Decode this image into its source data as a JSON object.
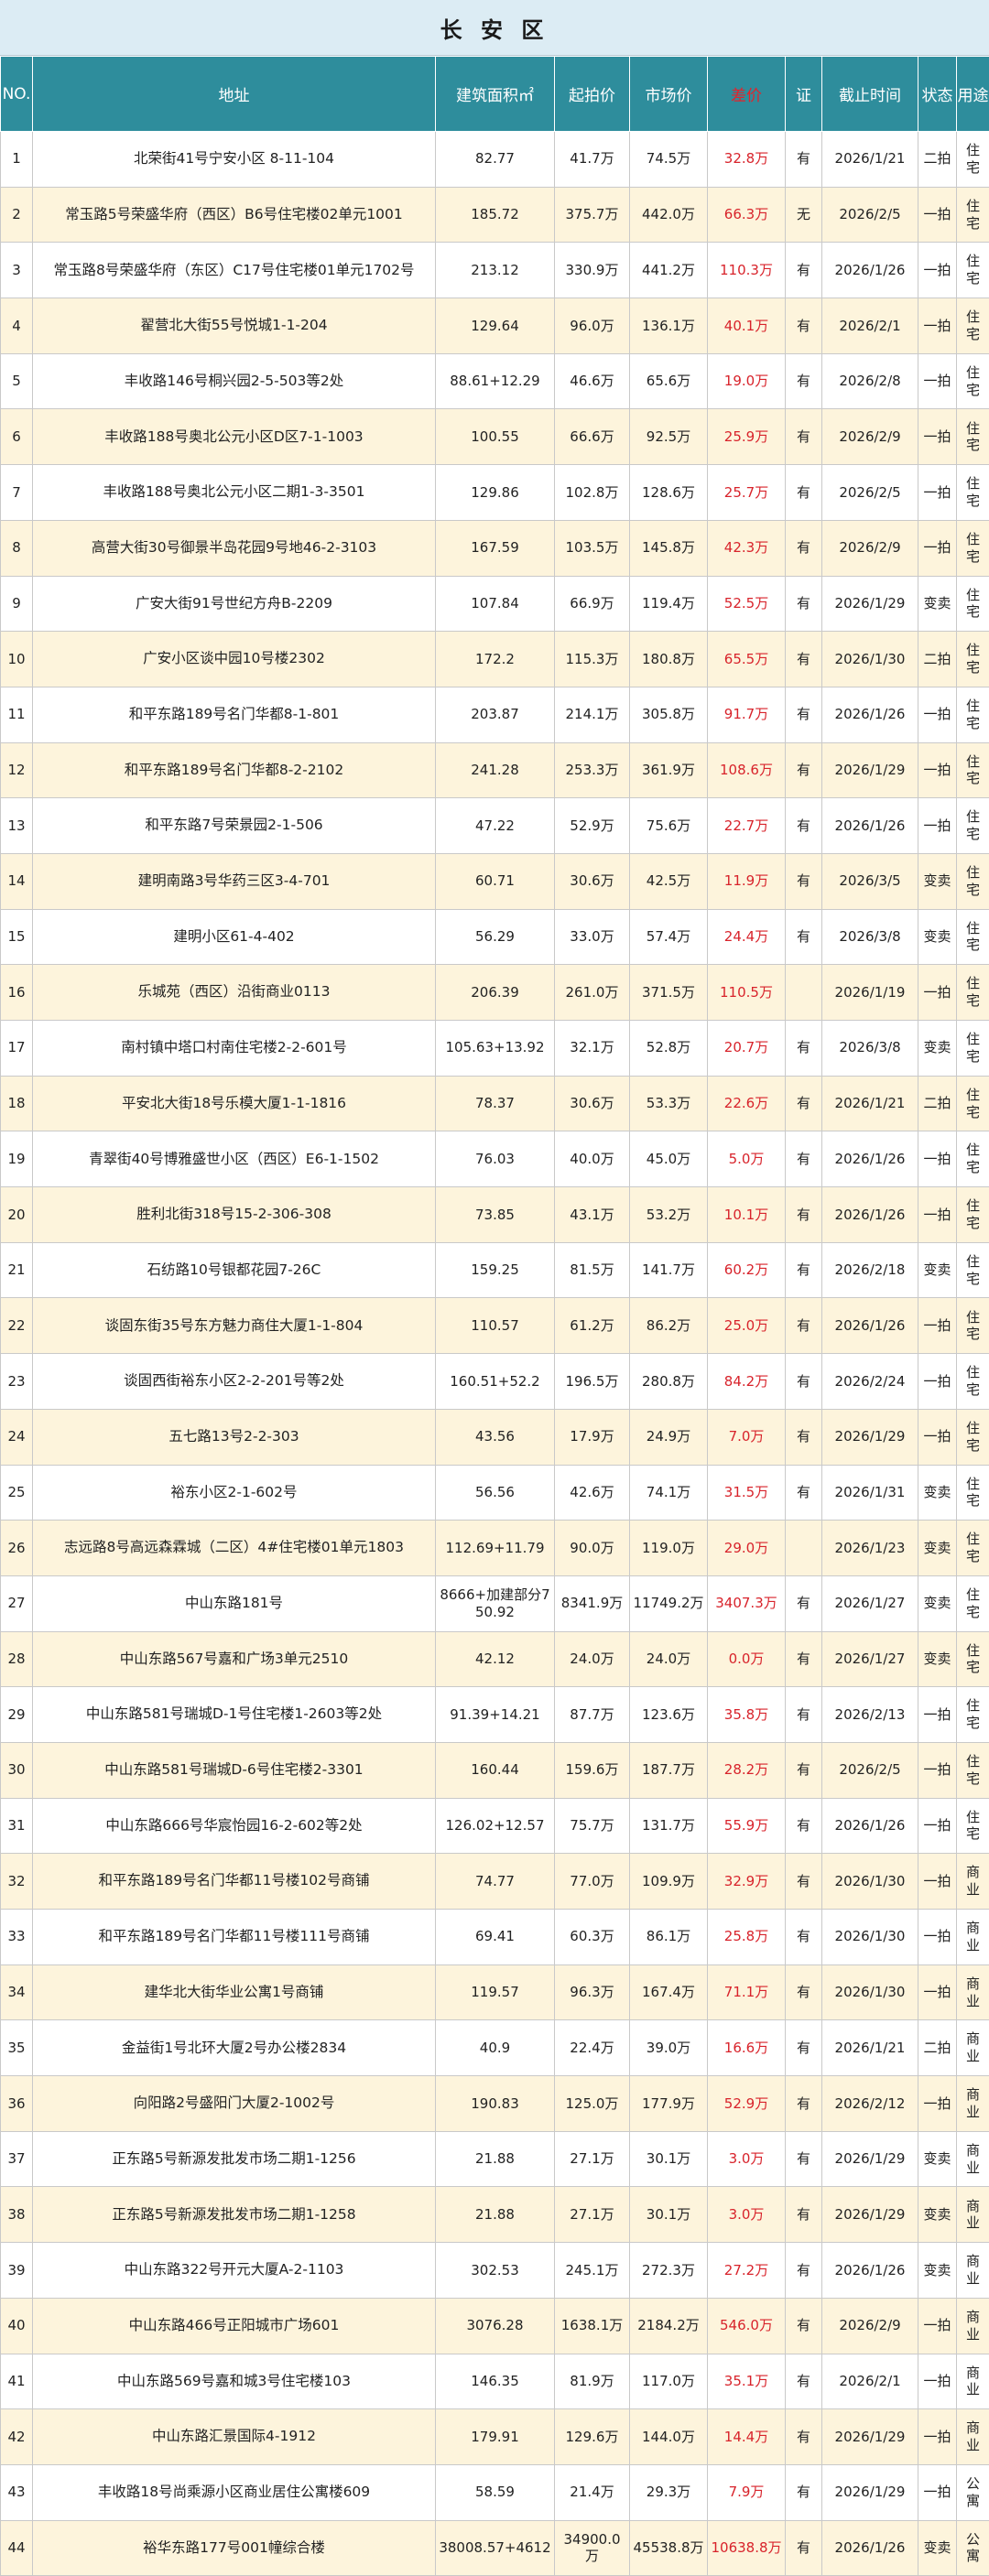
{
  "title": "长 安 区",
  "headers": {
    "no": "NO.",
    "address": "地址",
    "area": "建筑面积㎡",
    "start_price": "起拍价",
    "market_price": "市场价",
    "diff": "差价",
    "cert": "证",
    "deadline": "截止时间",
    "status": "状态",
    "usage": "用途"
  },
  "colors": {
    "header_bg": "#2e8d9c",
    "title_bg": "#dcecf4",
    "row_alt_bg": "#fdf4dc",
    "diff_color": "#d8232b"
  },
  "rows": [
    {
      "no": "1",
      "address": "北荣街41号宁安小区 8-11-104",
      "area": "82.77",
      "start": "41.7万",
      "market": "74.5万",
      "diff": "32.8万",
      "cert": "有",
      "deadline": "2026/1/21",
      "status": "二拍",
      "usage": "住宅"
    },
    {
      "no": "2",
      "address": "常玉路5号荣盛华府（西区）B6号住宅楼02单元1001",
      "area": "185.72",
      "start": "375.7万",
      "market": "442.0万",
      "diff": "66.3万",
      "cert": "无",
      "deadline": "2026/2/5",
      "status": "一拍",
      "usage": "住宅"
    },
    {
      "no": "3",
      "address": "常玉路8号荣盛华府（东区）C17号住宅楼01单元1702号",
      "area": "213.12",
      "start": "330.9万",
      "market": "441.2万",
      "diff": "110.3万",
      "cert": "有",
      "deadline": "2026/1/26",
      "status": "一拍",
      "usage": "住宅"
    },
    {
      "no": "4",
      "address": "翟营北大街55号悦城1-1-204",
      "area": "129.64",
      "start": "96.0万",
      "market": "136.1万",
      "diff": "40.1万",
      "cert": "有",
      "deadline": "2026/2/1",
      "status": "一拍",
      "usage": "住宅"
    },
    {
      "no": "5",
      "address": "丰收路146号桐兴园2-5-503等2处",
      "area": "88.61+12.29",
      "start": "46.6万",
      "market": "65.6万",
      "diff": "19.0万",
      "cert": "有",
      "deadline": "2026/2/8",
      "status": "一拍",
      "usage": "住宅"
    },
    {
      "no": "6",
      "address": "丰收路188号奥北公元小区D区7-1-1003",
      "area": "100.55",
      "start": "66.6万",
      "market": "92.5万",
      "diff": "25.9万",
      "cert": "有",
      "deadline": "2026/2/9",
      "status": "一拍",
      "usage": "住宅"
    },
    {
      "no": "7",
      "address": "丰收路188号奥北公元小区二期1-3-3501",
      "area": "129.86",
      "start": "102.8万",
      "market": "128.6万",
      "diff": "25.7万",
      "cert": "有",
      "deadline": "2026/2/5",
      "status": "一拍",
      "usage": "住宅"
    },
    {
      "no": "8",
      "address": "高营大街30号御景半岛花园9号地46-2-3103",
      "area": "167.59",
      "start": "103.5万",
      "market": "145.8万",
      "diff": "42.3万",
      "cert": "有",
      "deadline": "2026/2/9",
      "status": "一拍",
      "usage": "住宅"
    },
    {
      "no": "9",
      "address": "广安大街91号世纪方舟B-2209",
      "area": "107.84",
      "start": "66.9万",
      "market": "119.4万",
      "diff": "52.5万",
      "cert": "有",
      "deadline": "2026/1/29",
      "status": "变卖",
      "usage": "住宅"
    },
    {
      "no": "10",
      "address": "广安小区谈中园10号楼2302",
      "area": "172.2",
      "start": "115.3万",
      "market": "180.8万",
      "diff": "65.5万",
      "cert": "有",
      "deadline": "2026/1/30",
      "status": "二拍",
      "usage": "住宅"
    },
    {
      "no": "11",
      "address": "和平东路189号名门华都8-1-801",
      "area": "203.87",
      "start": "214.1万",
      "market": "305.8万",
      "diff": "91.7万",
      "cert": "有",
      "deadline": "2026/1/26",
      "status": "一拍",
      "usage": "住宅"
    },
    {
      "no": "12",
      "address": "和平东路189号名门华都8-2-2102",
      "area": "241.28",
      "start": "253.3万",
      "market": "361.9万",
      "diff": "108.6万",
      "cert": "有",
      "deadline": "2026/1/29",
      "status": "一拍",
      "usage": "住宅"
    },
    {
      "no": "13",
      "address": "和平东路7号荣景园2-1-506",
      "area": "47.22",
      "start": "52.9万",
      "market": "75.6万",
      "diff": "22.7万",
      "cert": "有",
      "deadline": "2026/1/26",
      "status": "一拍",
      "usage": "住宅"
    },
    {
      "no": "14",
      "address": "建明南路3号华药三区3-4-701",
      "area": "60.71",
      "start": "30.6万",
      "market": "42.5万",
      "diff": "11.9万",
      "cert": "有",
      "deadline": "2026/3/5",
      "status": "变卖",
      "usage": "住宅"
    },
    {
      "no": "15",
      "address": "建明小区61-4-402",
      "area": "56.29",
      "start": "33.0万",
      "market": "57.4万",
      "diff": "24.4万",
      "cert": "有",
      "deadline": "2026/3/8",
      "status": "变卖",
      "usage": "住宅"
    },
    {
      "no": "16",
      "address": "乐城苑（西区）沿街商业0113",
      "area": "206.39",
      "start": "261.0万",
      "market": "371.5万",
      "diff": "110.5万",
      "cert": "",
      "deadline": "2026/1/19",
      "status": "一拍",
      "usage": "住宅"
    },
    {
      "no": "17",
      "address": "南村镇中塔口村南住宅楼2-2-601号",
      "area": "105.63+13.92",
      "start": "32.1万",
      "market": "52.8万",
      "diff": "20.7万",
      "cert": "有",
      "deadline": "2026/3/8",
      "status": "变卖",
      "usage": "住宅"
    },
    {
      "no": "18",
      "address": "平安北大街18号乐模大厦1-1-1816",
      "area": "78.37",
      "start": "30.6万",
      "market": "53.3万",
      "diff": "22.6万",
      "cert": "有",
      "deadline": "2026/1/21",
      "status": "二拍",
      "usage": "住宅"
    },
    {
      "no": "19",
      "address": "青翠街40号博雅盛世小区（西区）E6-1-1502",
      "area": "76.03",
      "start": "40.0万",
      "market": "45.0万",
      "diff": "5.0万",
      "cert": "有",
      "deadline": "2026/1/26",
      "status": "一拍",
      "usage": "住宅"
    },
    {
      "no": "20",
      "address": "胜利北街318号15-2-306-308",
      "area": "73.85",
      "start": "43.1万",
      "market": "53.2万",
      "diff": "10.1万",
      "cert": "有",
      "deadline": "2026/1/26",
      "status": "一拍",
      "usage": "住宅"
    },
    {
      "no": "21",
      "address": "石纺路10号银都花园7-26C",
      "area": "159.25",
      "start": "81.5万",
      "market": "141.7万",
      "diff": "60.2万",
      "cert": "有",
      "deadline": "2026/2/18",
      "status": "变卖",
      "usage": "住宅"
    },
    {
      "no": "22",
      "address": "谈固东街35号东方魅力商住大厦1-1-804",
      "area": "110.57",
      "start": "61.2万",
      "market": "86.2万",
      "diff": "25.0万",
      "cert": "有",
      "deadline": "2026/1/26",
      "status": "一拍",
      "usage": "住宅"
    },
    {
      "no": "23",
      "address": "谈固西街裕东小区2-2-201号等2处",
      "area": "160.51+52.2",
      "start": "196.5万",
      "market": "280.8万",
      "diff": "84.2万",
      "cert": "有",
      "deadline": "2026/2/24",
      "status": "一拍",
      "usage": "住宅"
    },
    {
      "no": "24",
      "address": "五七路13号2-2-303",
      "area": "43.56",
      "start": "17.9万",
      "market": "24.9万",
      "diff": "7.0万",
      "cert": "有",
      "deadline": "2026/1/29",
      "status": "一拍",
      "usage": "住宅"
    },
    {
      "no": "25",
      "address": "裕东小区2-1-602号",
      "area": "56.56",
      "start": "42.6万",
      "market": "74.1万",
      "diff": "31.5万",
      "cert": "有",
      "deadline": "2026/1/31",
      "status": "变卖",
      "usage": "住宅"
    },
    {
      "no": "26",
      "address": "志远路8号高远森霖城（二区）4#住宅楼01单元1803",
      "area": "112.69+11.79",
      "start": "90.0万",
      "market": "119.0万",
      "diff": "29.0万",
      "cert": "",
      "deadline": "2026/1/23",
      "status": "变卖",
      "usage": "住宅"
    },
    {
      "no": "27",
      "address": "中山东路181号",
      "area": "8666+加建部分750.92",
      "start": "8341.9万",
      "market": "11749.2万",
      "diff": "3407.3万",
      "cert": "有",
      "deadline": "2026/1/27",
      "status": "变卖",
      "usage": "住宅"
    },
    {
      "no": "28",
      "address": "中山东路567号嘉和广场3单元2510",
      "area": "42.12",
      "start": "24.0万",
      "market": "24.0万",
      "diff": "0.0万",
      "cert": "有",
      "deadline": "2026/1/27",
      "status": "变卖",
      "usage": "住宅"
    },
    {
      "no": "29",
      "address": "中山东路581号瑞城D-1号住宅楼1-2603等2处",
      "area": "91.39+14.21",
      "start": "87.7万",
      "market": "123.6万",
      "diff": "35.8万",
      "cert": "有",
      "deadline": "2026/2/13",
      "status": "一拍",
      "usage": "住宅"
    },
    {
      "no": "30",
      "address": "中山东路581号瑞城D-6号住宅楼2-3301",
      "area": "160.44",
      "start": "159.6万",
      "market": "187.7万",
      "diff": "28.2万",
      "cert": "有",
      "deadline": "2026/2/5",
      "status": "一拍",
      "usage": "住宅"
    },
    {
      "no": "31",
      "address": "中山东路666号华宸怡园16-2-602等2处",
      "area": "126.02+12.57",
      "start": "75.7万",
      "market": "131.7万",
      "diff": "55.9万",
      "cert": "有",
      "deadline": "2026/1/26",
      "status": "一拍",
      "usage": "住宅"
    },
    {
      "no": "32",
      "address": "和平东路189号名门华都11号楼102号商铺",
      "area": "74.77",
      "start": "77.0万",
      "market": "109.9万",
      "diff": "32.9万",
      "cert": "有",
      "deadline": "2026/1/30",
      "status": "一拍",
      "usage": "商业"
    },
    {
      "no": "33",
      "address": "和平东路189号名门华都11号楼111号商铺",
      "area": "69.41",
      "start": "60.3万",
      "market": "86.1万",
      "diff": "25.8万",
      "cert": "有",
      "deadline": "2026/1/30",
      "status": "一拍",
      "usage": "商业"
    },
    {
      "no": "34",
      "address": "建华北大街华业公寓1号商铺",
      "area": "119.57",
      "start": "96.3万",
      "market": "167.4万",
      "diff": "71.1万",
      "cert": "有",
      "deadline": "2026/1/30",
      "status": "一拍",
      "usage": "商业"
    },
    {
      "no": "35",
      "address": "金益街1号北环大厦2号办公楼2834",
      "area": "40.9",
      "start": "22.4万",
      "market": "39.0万",
      "diff": "16.6万",
      "cert": "有",
      "deadline": "2026/1/21",
      "status": "二拍",
      "usage": "商业"
    },
    {
      "no": "36",
      "address": "向阳路2号盛阳门大厦2-1002号",
      "area": "190.83",
      "start": "125.0万",
      "market": "177.9万",
      "diff": "52.9万",
      "cert": "有",
      "deadline": "2026/2/12",
      "status": "一拍",
      "usage": "商业"
    },
    {
      "no": "37",
      "address": "正东路5号新源发批发市场二期1-1256",
      "area": "21.88",
      "start": "27.1万",
      "market": "30.1万",
      "diff": "3.0万",
      "cert": "有",
      "deadline": "2026/1/29",
      "status": "变卖",
      "usage": "商业"
    },
    {
      "no": "38",
      "address": "正东路5号新源发批发市场二期1-1258",
      "area": "21.88",
      "start": "27.1万",
      "market": "30.1万",
      "diff": "3.0万",
      "cert": "有",
      "deadline": "2026/1/29",
      "status": "变卖",
      "usage": "商业"
    },
    {
      "no": "39",
      "address": "中山东路322号开元大厦A-2-1103",
      "area": "302.53",
      "start": "245.1万",
      "market": "272.3万",
      "diff": "27.2万",
      "cert": "有",
      "deadline": "2026/1/26",
      "status": "变卖",
      "usage": "商业"
    },
    {
      "no": "40",
      "address": "中山东路466号正阳城市广场601",
      "area": "3076.28",
      "start": "1638.1万",
      "market": "2184.2万",
      "diff": "546.0万",
      "cert": "有",
      "deadline": "2026/2/9",
      "status": "一拍",
      "usage": "商业"
    },
    {
      "no": "41",
      "address": "中山东路569号嘉和城3号住宅楼103",
      "area": "146.35",
      "start": "81.9万",
      "market": "117.0万",
      "diff": "35.1万",
      "cert": "有",
      "deadline": "2026/2/1",
      "status": "一拍",
      "usage": "商业"
    },
    {
      "no": "42",
      "address": "中山东路汇景国际4-1912",
      "area": "179.91",
      "start": "129.6万",
      "market": "144.0万",
      "diff": "14.4万",
      "cert": "有",
      "deadline": "2026/1/29",
      "status": "一拍",
      "usage": "商业"
    },
    {
      "no": "43",
      "address": "丰收路18号尚乘源小区商业居住公寓楼609",
      "area": "58.59",
      "start": "21.4万",
      "market": "29.3万",
      "diff": "7.9万",
      "cert": "有",
      "deadline": "2026/1/29",
      "status": "一拍",
      "usage": "公寓"
    },
    {
      "no": "44",
      "address": "裕华东路177号001幢综合楼",
      "area": "38008.57+4612",
      "start": "34900.0万",
      "market": "45538.8万",
      "diff": "10638.8万",
      "cert": "有",
      "deadline": "2026/1/26",
      "status": "变卖",
      "usage": "公寓"
    }
  ]
}
